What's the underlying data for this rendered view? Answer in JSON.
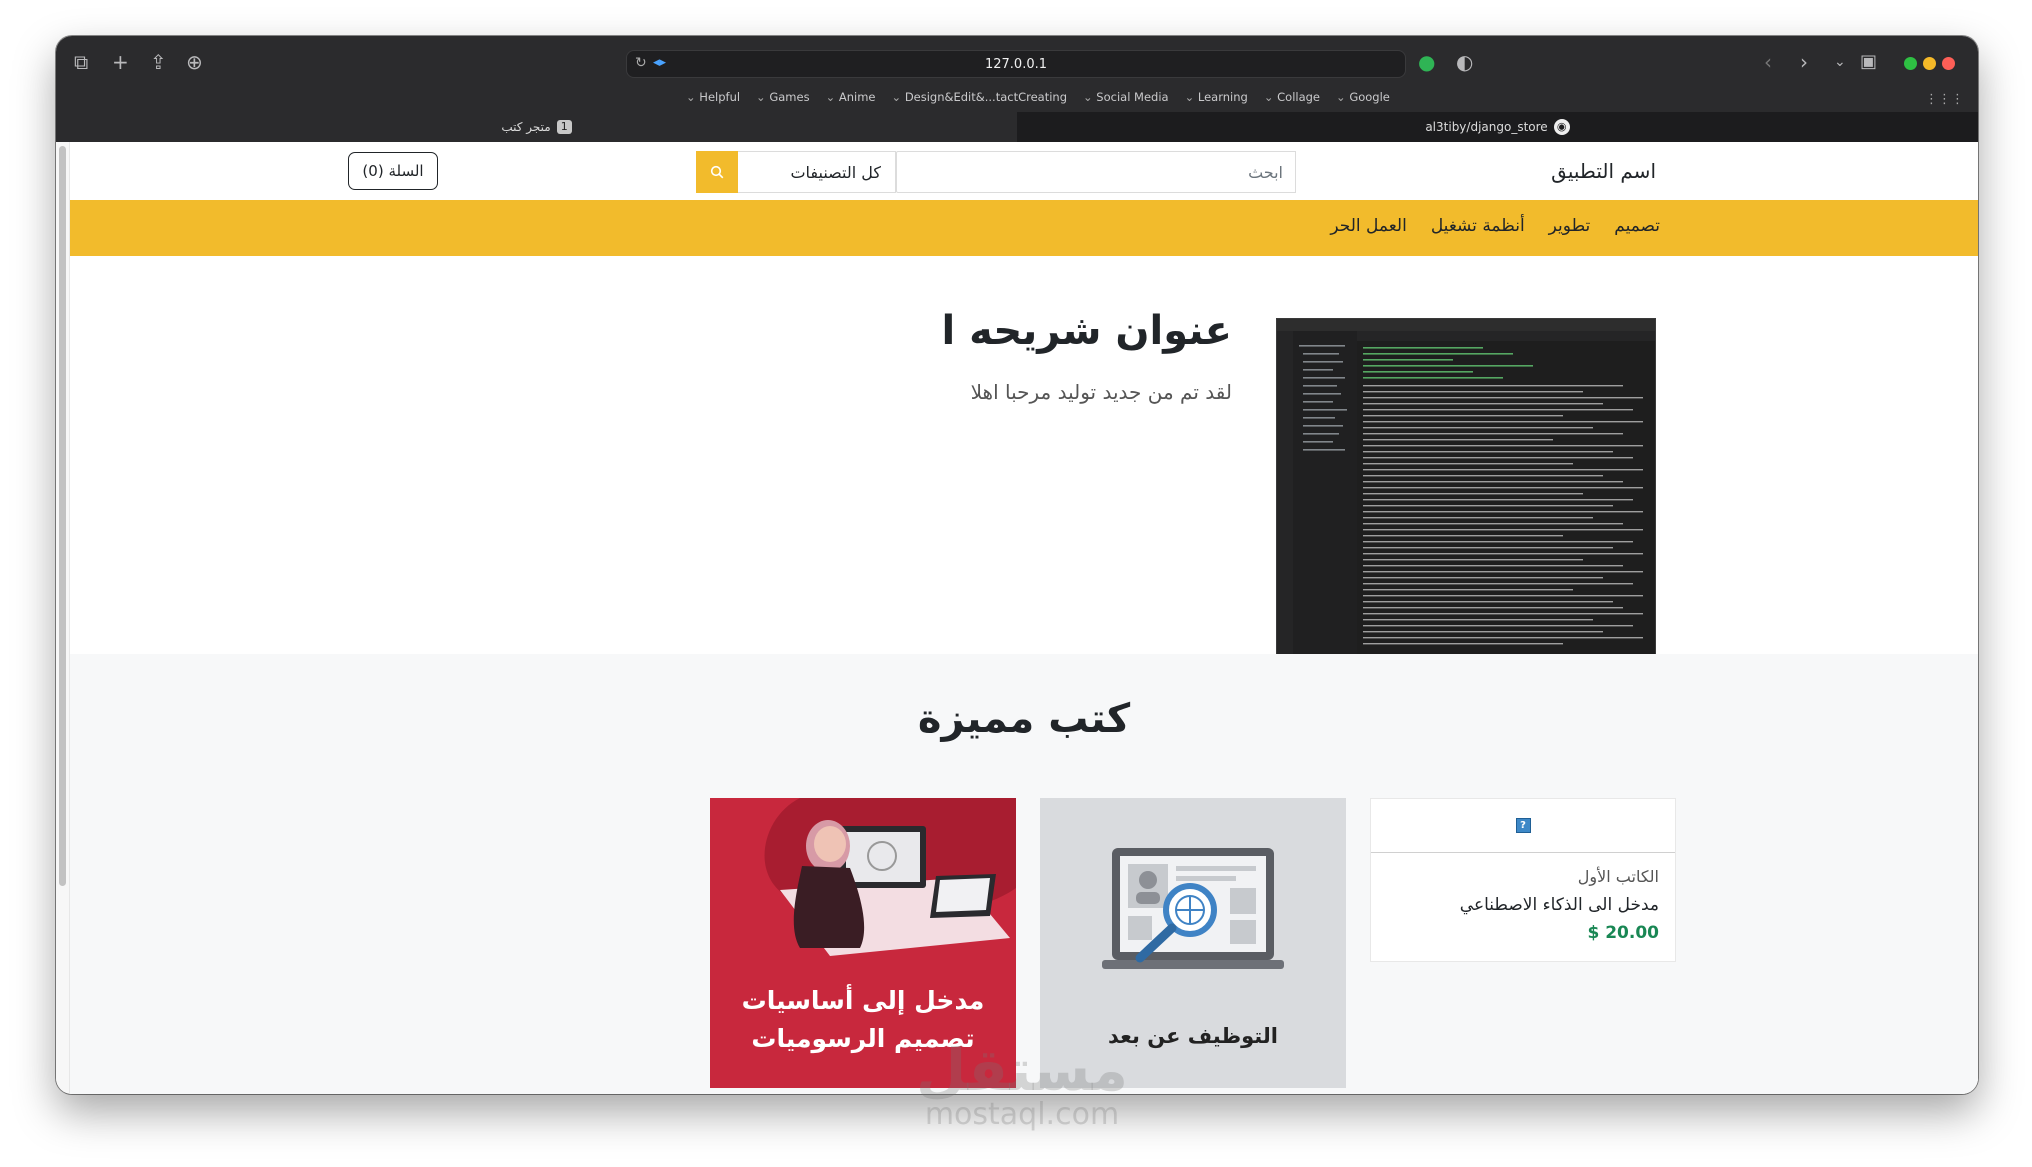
{
  "browser": {
    "url": "127.0.0.1",
    "bookmarks": [
      "Helpful",
      "Games",
      "Anime",
      "Design&Edit&...tactCreating",
      "Social Media",
      "Learning",
      "Collage",
      "Google"
    ],
    "tabs": [
      {
        "label": "متجر كتب",
        "badge": "1"
      },
      {
        "label": "al3tiby/django_store"
      }
    ]
  },
  "header": {
    "brand": "اسم التطبيق",
    "search_placeholder": "ابحث",
    "category_select": "كل التصنيفات",
    "cart_label": "السلة (0)"
  },
  "nav": {
    "items": [
      "تصميم",
      "تطوير",
      "أنظمة تشغيل",
      "العمل الحر"
    ]
  },
  "hero": {
    "title": "عنوان شريحه ا",
    "subtitle": "لقد تم من جديد توليد مرحبا اهلا"
  },
  "featured": {
    "title": "كتب مميزة",
    "cards": [
      {
        "author": "الكاتب الأول",
        "title": "مدخل الى الذكاء الاصطناعي",
        "price": "$ 20.00"
      },
      {
        "label": "التوظيف عن بعد"
      },
      {
        "label_line1": "مدخل إلى أساسيات",
        "label_line2": "تصميم الرسوميات"
      }
    ]
  },
  "watermark": {
    "ar": "مستقل",
    "en": "mostaql.com"
  },
  "colors": {
    "accent": "#f2bb2c",
    "price": "#198754",
    "card_red": "#c8283d"
  }
}
